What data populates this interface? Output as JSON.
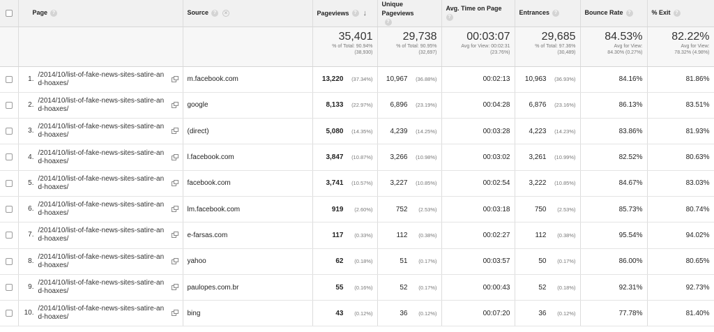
{
  "headers": {
    "page": "Page",
    "source": "Source",
    "pageviews": "Pageviews",
    "unique_pageviews": "Unique Pageviews",
    "avg_time": "Avg. Time on Page",
    "entrances": "Entrances",
    "bounce_rate": "Bounce Rate",
    "exit": "% Exit"
  },
  "totals": {
    "pageviews": {
      "value": "35,401",
      "line1": "% of Total: 90.94%",
      "line2": "(38,930)"
    },
    "unique_pageviews": {
      "value": "29,738",
      "line1": "% of Total: 90.95%",
      "line2": "(32,697)"
    },
    "avg_time": {
      "value": "00:03:07",
      "line1": "Avg for View: 00:02:31",
      "line2": "(23.76%)"
    },
    "entrances": {
      "value": "29,685",
      "line1": "% of Total: 97.36%",
      "line2": "(30,489)"
    },
    "bounce_rate": {
      "value": "84.53%",
      "line1": "Avg for View:",
      "line2": "84.30% (0.27%)"
    },
    "exit": {
      "value": "82.22%",
      "line1": "Avg for View:",
      "line2": "78.32% (4.98%)"
    }
  },
  "rows": [
    {
      "idx": "1.",
      "page": "/2014/10/list-of-fake-news-sites-satire-and-hoaxes/",
      "source": "m.facebook.com",
      "pv": "13,220",
      "pv_pct": "(37.34%)",
      "upv": "10,967",
      "upv_pct": "(36.88%)",
      "time": "00:02:13",
      "ent": "10,963",
      "ent_pct": "(36.93%)",
      "bounce": "84.16%",
      "exit": "81.86%"
    },
    {
      "idx": "2.",
      "page": "/2014/10/list-of-fake-news-sites-satire-and-hoaxes/",
      "source": "google",
      "pv": "8,133",
      "pv_pct": "(22.97%)",
      "upv": "6,896",
      "upv_pct": "(23.19%)",
      "time": "00:04:28",
      "ent": "6,876",
      "ent_pct": "(23.16%)",
      "bounce": "86.13%",
      "exit": "83.51%"
    },
    {
      "idx": "3.",
      "page": "/2014/10/list-of-fake-news-sites-satire-and-hoaxes/",
      "source": "(direct)",
      "pv": "5,080",
      "pv_pct": "(14.35%)",
      "upv": "4,239",
      "upv_pct": "(14.25%)",
      "time": "00:03:28",
      "ent": "4,223",
      "ent_pct": "(14.23%)",
      "bounce": "83.86%",
      "exit": "81.93%"
    },
    {
      "idx": "4.",
      "page": "/2014/10/list-of-fake-news-sites-satire-and-hoaxes/",
      "source": "l.facebook.com",
      "pv": "3,847",
      "pv_pct": "(10.87%)",
      "upv": "3,266",
      "upv_pct": "(10.98%)",
      "time": "00:03:02",
      "ent": "3,261",
      "ent_pct": "(10.99%)",
      "bounce": "82.52%",
      "exit": "80.63%"
    },
    {
      "idx": "5.",
      "page": "/2014/10/list-of-fake-news-sites-satire-and-hoaxes/",
      "source": "facebook.com",
      "pv": "3,741",
      "pv_pct": "(10.57%)",
      "upv": "3,227",
      "upv_pct": "(10.85%)",
      "time": "00:02:54",
      "ent": "3,222",
      "ent_pct": "(10.85%)",
      "bounce": "84.67%",
      "exit": "83.03%"
    },
    {
      "idx": "6.",
      "page": "/2014/10/list-of-fake-news-sites-satire-and-hoaxes/",
      "source": "lm.facebook.com",
      "pv": "919",
      "pv_pct": "(2.60%)",
      "upv": "752",
      "upv_pct": "(2.53%)",
      "time": "00:03:18",
      "ent": "750",
      "ent_pct": "(2.53%)",
      "bounce": "85.73%",
      "exit": "80.74%"
    },
    {
      "idx": "7.",
      "page": "/2014/10/list-of-fake-news-sites-satire-and-hoaxes/",
      "source": "e-farsas.com",
      "pv": "117",
      "pv_pct": "(0.33%)",
      "upv": "112",
      "upv_pct": "(0.38%)",
      "time": "00:02:27",
      "ent": "112",
      "ent_pct": "(0.38%)",
      "bounce": "95.54%",
      "exit": "94.02%"
    },
    {
      "idx": "8.",
      "page": "/2014/10/list-of-fake-news-sites-satire-and-hoaxes/",
      "source": "yahoo",
      "pv": "62",
      "pv_pct": "(0.18%)",
      "upv": "51",
      "upv_pct": "(0.17%)",
      "time": "00:03:57",
      "ent": "50",
      "ent_pct": "(0.17%)",
      "bounce": "86.00%",
      "exit": "80.65%"
    },
    {
      "idx": "9.",
      "page": "/2014/10/list-of-fake-news-sites-satire-and-hoaxes/",
      "source": "paulopes.com.br",
      "pv": "55",
      "pv_pct": "(0.16%)",
      "upv": "52",
      "upv_pct": "(0.17%)",
      "time": "00:00:43",
      "ent": "52",
      "ent_pct": "(0.18%)",
      "bounce": "92.31%",
      "exit": "92.73%"
    },
    {
      "idx": "10.",
      "page": "/2014/10/list-of-fake-news-sites-satire-and-hoaxes/",
      "source": "bing",
      "pv": "43",
      "pv_pct": "(0.12%)",
      "upv": "36",
      "upv_pct": "(0.12%)",
      "time": "00:07:20",
      "ent": "36",
      "ent_pct": "(0.12%)",
      "bounce": "77.78%",
      "exit": "81.40%"
    }
  ]
}
